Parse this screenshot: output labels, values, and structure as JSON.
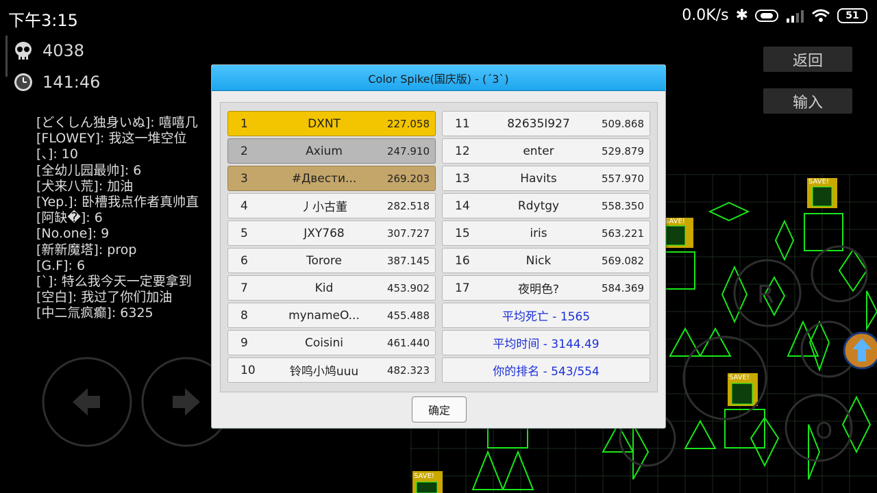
{
  "status_bar": {
    "time": "下午3:15",
    "network_speed": "0.0K/s",
    "battery": "51"
  },
  "stats": {
    "deaths": "4038",
    "time": "141:46"
  },
  "chat_lines": [
    "[どくしん独身いぬ]: 嘻嘻几",
    "[FLOWEY]: 我这一堆空位",
    "[、]: 10",
    "[全幼儿园最帅]: 6",
    "[犬来八荒]: 加油",
    "[Yep.]: 卧槽我点作者真帅直",
    "[阿缺�]: 6",
    "[No.one]: 9",
    "[新新魔塔]: prop",
    "[G.F]: 6",
    "[`]: 特么我今天一定要拿到",
    "[空白]: 我过了你们加油",
    "[中二氚疯癫]: 6325"
  ],
  "side_buttons": {
    "back": "返回",
    "input": "输入"
  },
  "dialog": {
    "title": "Color Spike(国庆版) - (ˊ3ˋ)",
    "ok": "确定",
    "left_column": [
      {
        "rank": "1",
        "name": "DXNT",
        "score": "227.058"
      },
      {
        "rank": "2",
        "name": "Axium",
        "score": "247.910"
      },
      {
        "rank": "3",
        "name": "#Двести...",
        "score": "269.203"
      },
      {
        "rank": "4",
        "name": "丿小古董",
        "score": "282.518"
      },
      {
        "rank": "5",
        "name": "JXY768",
        "score": "307.727"
      },
      {
        "rank": "6",
        "name": "Torore",
        "score": "387.145"
      },
      {
        "rank": "7",
        "name": "Kid",
        "score": "453.902"
      },
      {
        "rank": "8",
        "name": "mynameO...",
        "score": "455.488"
      },
      {
        "rank": "9",
        "name": "Coisini",
        "score": "461.440"
      },
      {
        "rank": "10",
        "name": "铃鸣小鸠uuu",
        "score": "482.323"
      }
    ],
    "right_column": [
      {
        "rank": "11",
        "name": "82635I927",
        "score": "509.868"
      },
      {
        "rank": "12",
        "name": "enter",
        "score": "529.879"
      },
      {
        "rank": "13",
        "name": "Havits",
        "score": "557.970"
      },
      {
        "rank": "14",
        "name": "Rdytgy",
        "score": "558.350"
      },
      {
        "rank": "15",
        "name": "iris",
        "score": "563.221"
      },
      {
        "rank": "16",
        "name": "Nick",
        "score": "569.082"
      },
      {
        "rank": "17",
        "name": "夜明色?",
        "score": "584.369"
      }
    ],
    "summary": {
      "avg_deaths": "平均死亡 - 1565",
      "avg_time": "平均时间 - 3144.49",
      "your_rank": "你的排名 - 543/554"
    }
  },
  "game_labels": {
    "save": "SAVE!"
  },
  "colors": {
    "title_bar": "#1ea6ee",
    "gold": "#f3c400",
    "silver": "#b8b8b8",
    "bronze": "#c4a66a",
    "summary_text": "#1a2fd8",
    "spike_green": "#19e619"
  }
}
